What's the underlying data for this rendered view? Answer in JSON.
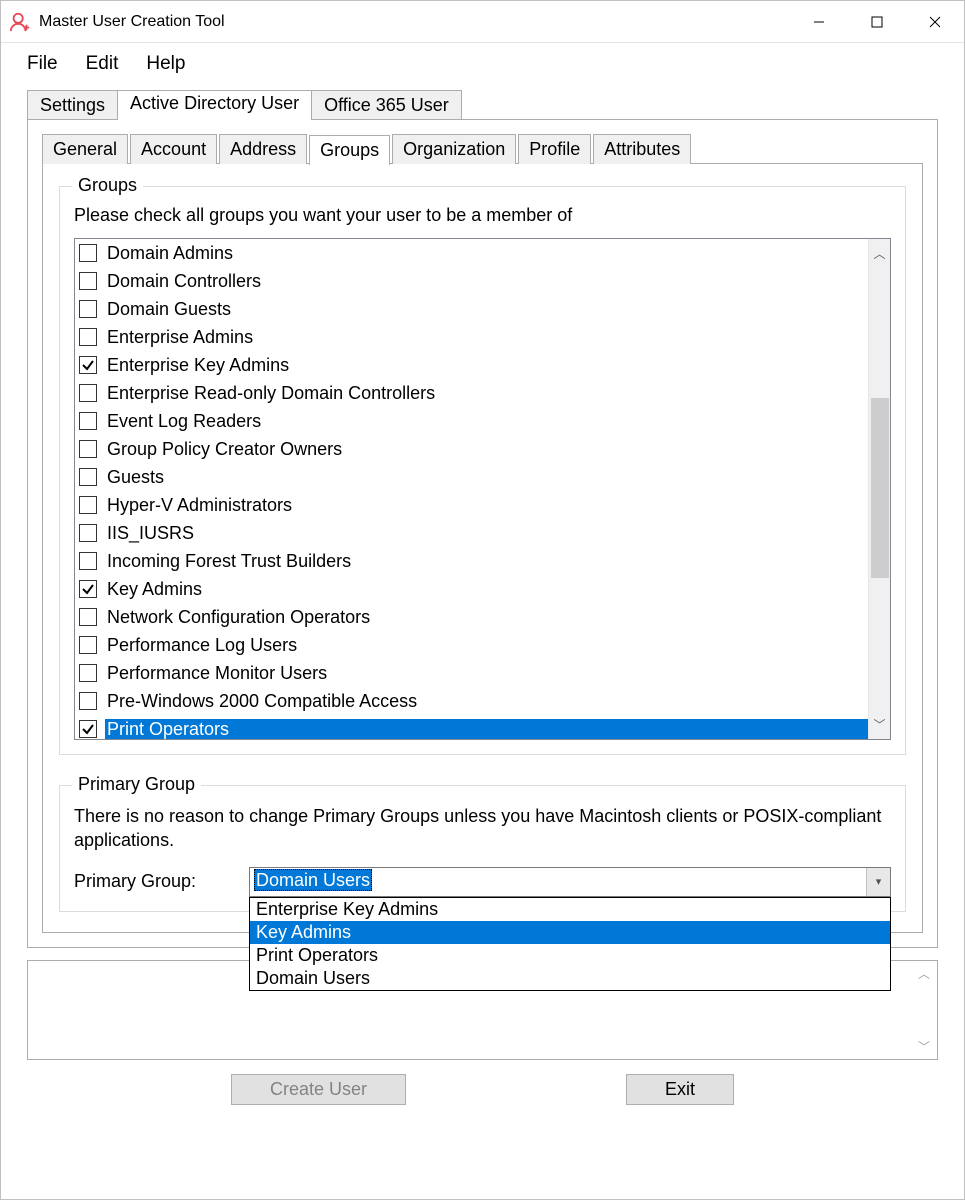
{
  "window": {
    "title": "Master User Creation Tool"
  },
  "menu": {
    "file": "File",
    "edit": "Edit",
    "help": "Help"
  },
  "outer_tabs": {
    "settings": "Settings",
    "ad_user": "Active Directory User",
    "o365": "Office 365 User"
  },
  "inner_tabs": {
    "general": "General",
    "account": "Account",
    "address": "Address",
    "groups": "Groups",
    "organization": "Organization",
    "profile": "Profile",
    "attributes": "Attributes"
  },
  "groups_box": {
    "legend": "Groups",
    "instruction": "Please check all groups you want your user to be a member of",
    "items": [
      {
        "label": "Domain Admins",
        "checked": false,
        "selected": false
      },
      {
        "label": "Domain Controllers",
        "checked": false,
        "selected": false
      },
      {
        "label": "Domain Guests",
        "checked": false,
        "selected": false
      },
      {
        "label": "Enterprise Admins",
        "checked": false,
        "selected": false
      },
      {
        "label": "Enterprise Key Admins",
        "checked": true,
        "selected": false
      },
      {
        "label": "Enterprise Read-only Domain Controllers",
        "checked": false,
        "selected": false
      },
      {
        "label": "Event Log Readers",
        "checked": false,
        "selected": false
      },
      {
        "label": "Group Policy Creator Owners",
        "checked": false,
        "selected": false
      },
      {
        "label": "Guests",
        "checked": false,
        "selected": false
      },
      {
        "label": "Hyper-V Administrators",
        "checked": false,
        "selected": false
      },
      {
        "label": "IIS_IUSRS",
        "checked": false,
        "selected": false
      },
      {
        "label": "Incoming Forest Trust Builders",
        "checked": false,
        "selected": false
      },
      {
        "label": "Key Admins",
        "checked": true,
        "selected": false
      },
      {
        "label": "Network Configuration Operators",
        "checked": false,
        "selected": false
      },
      {
        "label": "Performance Log Users",
        "checked": false,
        "selected": false
      },
      {
        "label": "Performance Monitor Users",
        "checked": false,
        "selected": false
      },
      {
        "label": "Pre-Windows 2000 Compatible Access",
        "checked": false,
        "selected": false
      },
      {
        "label": "Print Operators",
        "checked": true,
        "selected": true
      }
    ]
  },
  "primary_group_box": {
    "legend": "Primary Group",
    "instruction": "There is no reason to change Primary Groups unless you have Macintosh clients or POSIX-compliant applications.",
    "label": "Primary Group:",
    "selected": "Domain Users",
    "options": [
      {
        "label": "Enterprise Key Admins",
        "hover": false
      },
      {
        "label": "Key Admins",
        "hover": true
      },
      {
        "label": "Print Operators",
        "hover": false
      },
      {
        "label": "Domain Users",
        "hover": false
      }
    ]
  },
  "footer": {
    "create": "Create User",
    "exit": "Exit"
  }
}
